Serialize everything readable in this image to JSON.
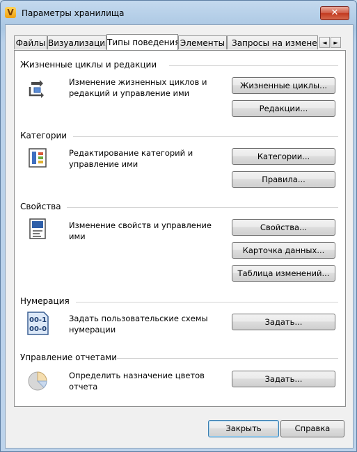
{
  "window": {
    "title": "Параметры хранилища",
    "app_icon_letter": "V",
    "close_symbol": "✕"
  },
  "tabs": [
    {
      "label": "Файлы",
      "active": false
    },
    {
      "label": "Визуализация",
      "active": false
    },
    {
      "label": "Типы поведения",
      "active": true
    },
    {
      "label": "Элементы",
      "active": false
    },
    {
      "label": "Запросы на изменение",
      "active": false
    }
  ],
  "tab_scroll": {
    "left": "◄",
    "right": "►"
  },
  "sections": {
    "lifecycles": {
      "title": "Жизненные циклы и редакции",
      "icon": "lifecycle-icon",
      "description": "Изменение жизненных циклов и редакций и управление ими",
      "button_1": "Жизненные циклы...",
      "button_2": "Редакции..."
    },
    "categories": {
      "title": "Категории",
      "icon": "categories-icon",
      "description": "Редактирование категорий и управление ими",
      "button_1": "Категории...",
      "button_2": "Правила..."
    },
    "properties": {
      "title": "Свойства",
      "icon": "properties-icon",
      "description": "Изменение свойств и управление ими",
      "button_1": "Свойства...",
      "button_2": "Карточка данных...",
      "button_3": "Таблица изменений..."
    },
    "numbering": {
      "title": "Нумерация",
      "icon": "numbering-icon",
      "icon_text_1": "00-1",
      "icon_text_2": "00-0",
      "description": "Задать пользовательские схемы нумерации",
      "button_1": "Задать..."
    },
    "reports": {
      "title": "Управление отчетами",
      "icon": "pie-chart-icon",
      "description": "Определить назначение цветов отчета",
      "button_1": "Задать..."
    }
  },
  "footer": {
    "close_label": "Закрыть",
    "help_label": "Справка"
  }
}
